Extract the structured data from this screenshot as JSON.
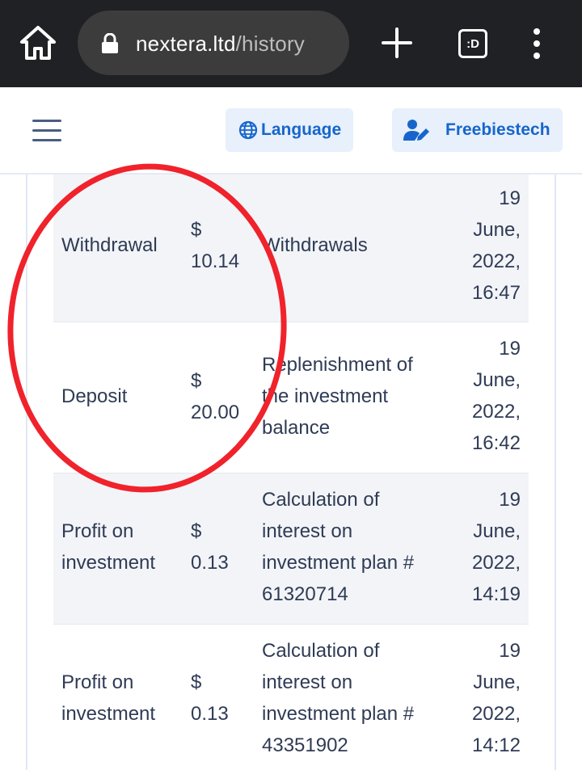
{
  "browser": {
    "url_domain": "nextera.ltd",
    "url_path": "/history",
    "tabs_label": ":D",
    "icons": [
      "home-icon",
      "lock-icon",
      "new-tab-icon",
      "tab-switcher-icon",
      "more-vert-icon"
    ]
  },
  "header": {
    "language_label": "Language",
    "user_label": "Freebiestech",
    "icons": [
      "hamburger-menu-icon",
      "globe-icon",
      "user-edit-icon"
    ],
    "accent_color": "#1765cc"
  },
  "history": {
    "rows": [
      {
        "type": [
          "Withdrawal"
        ],
        "amount": [
          "$",
          "10.14"
        ],
        "description": [
          "Withdrawals"
        ],
        "date": [
          "19",
          "June,",
          "2022,",
          "16:47"
        ]
      },
      {
        "type": [
          "Deposit"
        ],
        "amount": [
          "$",
          "20.00"
        ],
        "description": [
          "Replenishment of",
          "the investment",
          "balance"
        ],
        "date": [
          "19",
          "June,",
          "2022,",
          "16:42"
        ]
      },
      {
        "type": [
          "Profit on",
          "investment"
        ],
        "amount": [
          "$",
          "0.13"
        ],
        "description": [
          "Calculation of",
          "interest on",
          "investment plan #",
          "61320714"
        ],
        "date": [
          "19",
          "June,",
          "2022,",
          "14:19"
        ]
      },
      {
        "type": [
          "Profit on",
          "investment"
        ],
        "amount": [
          "$",
          "0.13"
        ],
        "description": [
          "Calculation of",
          "interest on",
          "investment plan #",
          "43351902"
        ],
        "date": [
          "19",
          "June,",
          "2022,",
          "14:12"
        ]
      }
    ]
  },
  "annotation": {
    "shape": "ellipse",
    "color": "#f0222b"
  }
}
